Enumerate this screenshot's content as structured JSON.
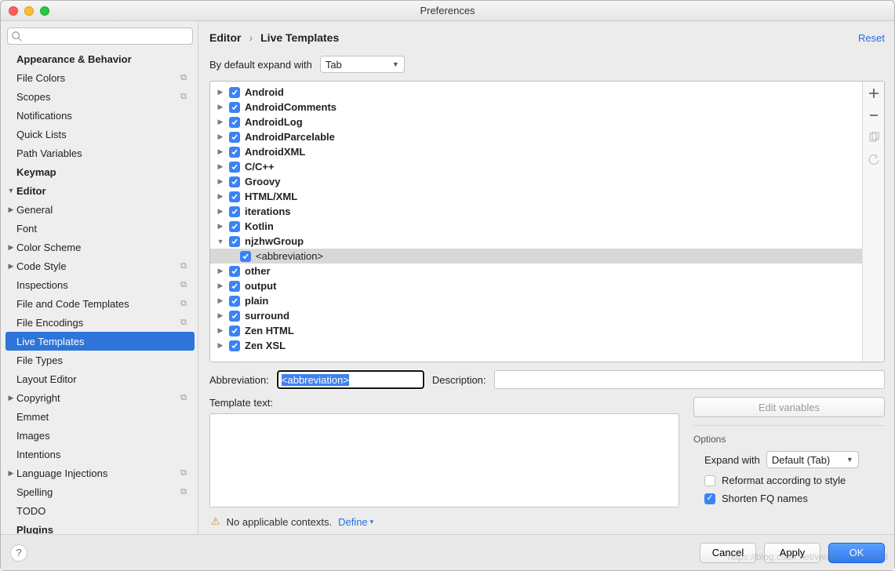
{
  "window": {
    "title": "Preferences"
  },
  "search": {
    "placeholder": ""
  },
  "sidebar": {
    "items": [
      {
        "label": "Appearance & Behavior",
        "bold": true,
        "indent": 0,
        "arrow": ""
      },
      {
        "label": "File Colors",
        "indent": 2,
        "badge": "⧉"
      },
      {
        "label": "Scopes",
        "indent": 2,
        "badge": "⧉"
      },
      {
        "label": "Notifications",
        "indent": 2
      },
      {
        "label": "Quick Lists",
        "indent": 2
      },
      {
        "label": "Path Variables",
        "indent": 2
      },
      {
        "label": "Keymap",
        "bold": true,
        "indent": 0
      },
      {
        "label": "Editor",
        "bold": true,
        "indent": 0,
        "arrow": "▼"
      },
      {
        "label": "General",
        "indent": 1,
        "arrow": "▶"
      },
      {
        "label": "Font",
        "indent": 1,
        "arrow": ""
      },
      {
        "label": "Color Scheme",
        "indent": 1,
        "arrow": "▶"
      },
      {
        "label": "Code Style",
        "indent": 1,
        "arrow": "▶",
        "badge": "⧉"
      },
      {
        "label": "Inspections",
        "indent": 1,
        "badge": "⧉"
      },
      {
        "label": "File and Code Templates",
        "indent": 1,
        "badge": "⧉"
      },
      {
        "label": "File Encodings",
        "indent": 1,
        "badge": "⧉"
      },
      {
        "label": "Live Templates",
        "indent": 1,
        "selected": true
      },
      {
        "label": "File Types",
        "indent": 1
      },
      {
        "label": "Layout Editor",
        "indent": 1
      },
      {
        "label": "Copyright",
        "indent": 1,
        "arrow": "▶",
        "badge": "⧉"
      },
      {
        "label": "Emmet",
        "indent": 1
      },
      {
        "label": "Images",
        "indent": 1
      },
      {
        "label": "Intentions",
        "indent": 1
      },
      {
        "label": "Language Injections",
        "indent": 1,
        "arrow": "▶",
        "badge": "⧉"
      },
      {
        "label": "Spelling",
        "indent": 1,
        "badge": "⧉"
      },
      {
        "label": "TODO",
        "indent": 1
      },
      {
        "label": "Plugins",
        "bold": true,
        "indent": 0
      }
    ]
  },
  "breadcrumb": {
    "root": "Editor",
    "sep": "›",
    "leaf": "Live Templates"
  },
  "reset": "Reset",
  "expand": {
    "label": "By default expand with",
    "value": "Tab"
  },
  "template_groups": [
    {
      "name": "Android",
      "checked": true,
      "exp": "▶"
    },
    {
      "name": "AndroidComments",
      "checked": true,
      "exp": "▶"
    },
    {
      "name": "AndroidLog",
      "checked": true,
      "exp": "▶"
    },
    {
      "name": "AndroidParcelable",
      "checked": true,
      "exp": "▶"
    },
    {
      "name": "AndroidXML",
      "checked": true,
      "exp": "▶"
    },
    {
      "name": "C/C++",
      "checked": true,
      "exp": "▶"
    },
    {
      "name": "Groovy",
      "checked": true,
      "exp": "▶"
    },
    {
      "name": "HTML/XML",
      "checked": true,
      "exp": "▶"
    },
    {
      "name": "iterations",
      "checked": true,
      "exp": "▶"
    },
    {
      "name": "Kotlin",
      "checked": true,
      "exp": "▶"
    },
    {
      "name": "njzhwGroup",
      "checked": true,
      "exp": "▼",
      "children": [
        {
          "name": "<abbreviation>",
          "checked": true,
          "selected": true
        }
      ]
    },
    {
      "name": "other",
      "checked": true,
      "exp": "▶"
    },
    {
      "name": "output",
      "checked": true,
      "exp": "▶"
    },
    {
      "name": "plain",
      "checked": true,
      "exp": "▶"
    },
    {
      "name": "surround",
      "checked": true,
      "exp": "▶"
    },
    {
      "name": "Zen HTML",
      "checked": true,
      "exp": "▶"
    },
    {
      "name": "Zen XSL",
      "checked": true,
      "exp": "▶"
    }
  ],
  "form": {
    "abbr_label": "Abbreviation:",
    "abbr_value": "<abbreviation>",
    "desc_label": "Description:",
    "desc_value": "",
    "template_text_label": "Template text:",
    "edit_vars": "Edit variables",
    "options_header": "Options",
    "expand_with_label": "Expand with",
    "expand_with_value": "Default (Tab)",
    "reformat_label": "Reformat according to style",
    "reformat_checked": false,
    "shorten_label": "Shorten FQ names",
    "shorten_checked": true,
    "no_ctx": "No applicable contexts.",
    "define": "Define"
  },
  "footer": {
    "cancel": "Cancel",
    "apply": "Apply",
    "ok": "OK"
  },
  "watermark": "https://blog.csdn.net/weixin_44080903"
}
